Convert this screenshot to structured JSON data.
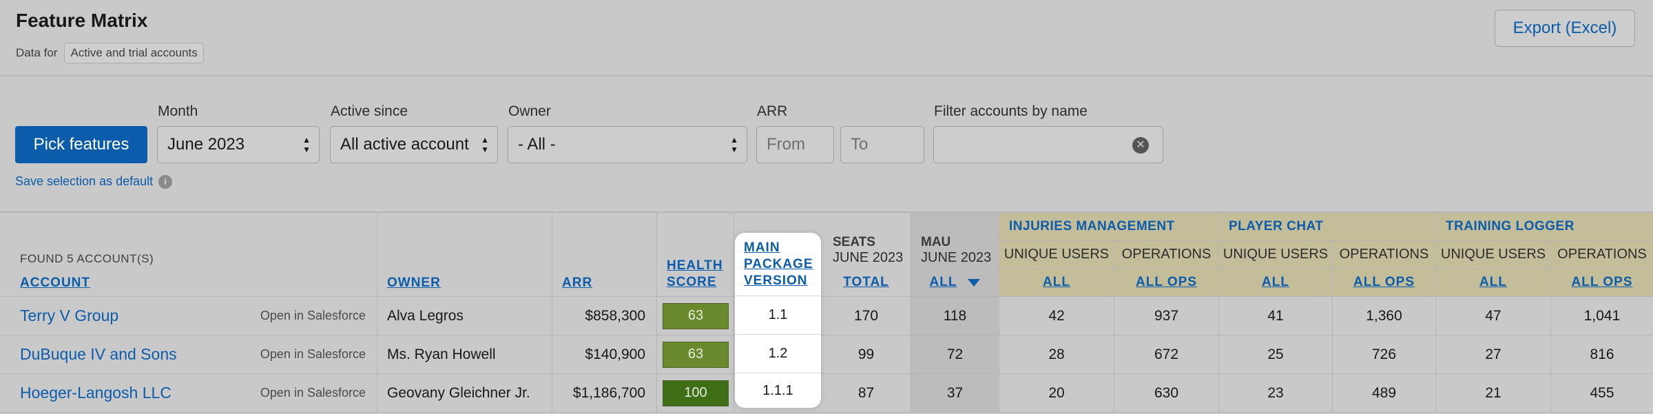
{
  "header": {
    "title": "Feature Matrix",
    "data_for_label": "Data for",
    "data_for_value": "Active and trial accounts",
    "export_label": "Export (Excel)"
  },
  "filters": {
    "pick_features_label": "Pick features",
    "month": {
      "label": "Month",
      "value": "June 2023"
    },
    "active_since": {
      "label": "Active since",
      "value": "All active account"
    },
    "owner": {
      "label": "Owner",
      "value": "- All -"
    },
    "arr": {
      "label": "ARR",
      "from_placeholder": "From",
      "to_placeholder": "To"
    },
    "name_filter": {
      "label": "Filter accounts by name",
      "value": ""
    },
    "save_default_label": "Save selection as default",
    "info_glyph": "i",
    "clear_glyph": "✕"
  },
  "table": {
    "found_label": "FOUND 5 ACCOUNT(S)",
    "columns": {
      "account": "ACCOUNT",
      "owner": "OWNER",
      "arr": "ARR",
      "health_line1": "HEALTH",
      "health_line2": "SCORE",
      "mpv_line1": "MAIN",
      "mpv_line2": "PACKAGE",
      "mpv_line3": "VERSION",
      "seats_title": "SEATS",
      "seats_period": "JUNE 2023",
      "seats_link": "TOTAL",
      "mau_title": "MAU",
      "mau_period": "JUNE 2023",
      "mau_link": "ALL"
    },
    "groups": [
      {
        "title": "INJURIES MANAGEMENT",
        "sub1": "UNIQUE USERS",
        "sub2": "OPERATIONS",
        "link1": "ALL",
        "link2": "ALL OPS"
      },
      {
        "title": "PLAYER CHAT",
        "sub1": "UNIQUE USERS",
        "sub2": "OPERATIONS",
        "link1": "ALL",
        "link2": "ALL OPS"
      },
      {
        "title": "TRAINING LOGGER",
        "sub1": "UNIQUE USERS",
        "sub2": "OPERATIONS",
        "link1": "ALL",
        "link2": "ALL OPS"
      }
    ],
    "open_in_sf_label": "Open in Salesforce",
    "rows": [
      {
        "account": "Terry V Group",
        "owner": "Alva Legros",
        "arr": "$858,300",
        "health": "63",
        "health_color": "#6b8a2e",
        "mpv": "1.1",
        "seats": "170",
        "mau": "118",
        "g": [
          "42",
          "937",
          "41",
          "1,360",
          "47",
          "1,041"
        ]
      },
      {
        "account": "DuBuque IV and Sons",
        "owner": "Ms. Ryan Howell",
        "arr": "$140,900",
        "health": "63",
        "health_color": "#6b8a2e",
        "mpv": "1.2",
        "seats": "99",
        "mau": "72",
        "g": [
          "28",
          "672",
          "25",
          "726",
          "27",
          "816"
        ]
      },
      {
        "account": "Hoeger-Langosh LLC",
        "owner": "Geovany Gleichner Jr.",
        "arr": "$1,186,700",
        "health": "100",
        "health_color": "#3f6e16",
        "mpv": "1.1.1",
        "seats": "87",
        "mau": "37",
        "g": [
          "20",
          "630",
          "23",
          "489",
          "21",
          "455"
        ]
      }
    ]
  }
}
